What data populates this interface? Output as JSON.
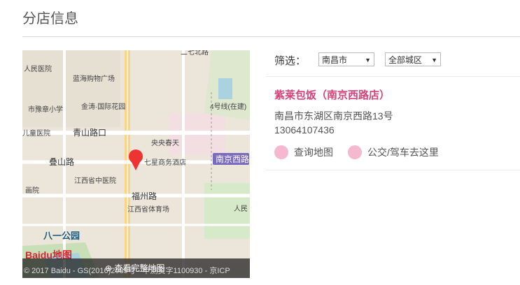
{
  "page": {
    "title": "分店信息"
  },
  "filter": {
    "label": "筛选：",
    "city": "南昌市",
    "district": "全部城区"
  },
  "shop": {
    "name": "紫莱包饭（南京西路店）",
    "address": "南昌市东湖区南京西路13号",
    "phone": "13064107436",
    "map_link": "查询地图",
    "route_link": "公交/驾车去这里"
  },
  "map": {
    "view_full": "查看完整地图",
    "copyright": "© 2017 Baidu - GS(2016)2089号 - 甲测资字1100930 - 京ICP",
    "logo": "Baidu地图",
    "labels": {
      "hospital1": "人民医院",
      "mall": "蓝海购物广场",
      "school": "市豫章小学",
      "garden": "金涛·国际花园",
      "child_hosp": "儿童医院",
      "qingshan": "青山路口",
      "yangchun": "央央春天",
      "hotel": "七星商务酒店",
      "nanjing": "南京西路",
      "dieshan": "叠山路",
      "tcm": "江西省中医院",
      "fuzhou": "福州路",
      "stadium": "江西省体育场",
      "park": "八一公园",
      "painting": "画院",
      "road4": "4号线(在建)",
      "renmin": "人民",
      "top": "二七北路"
    }
  }
}
